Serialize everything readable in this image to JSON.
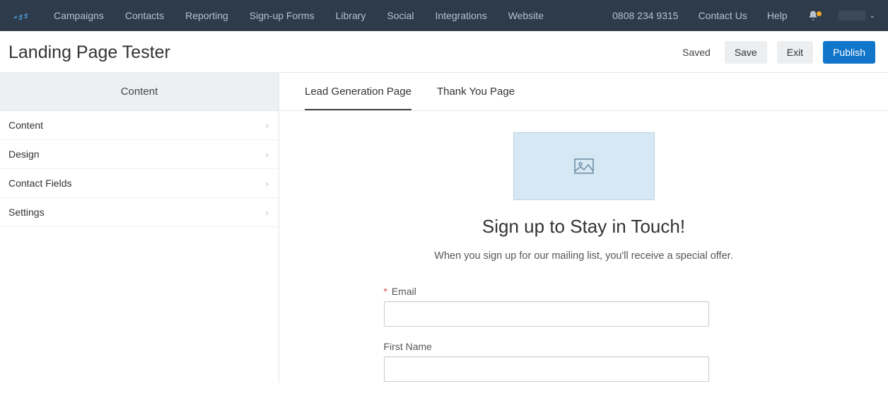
{
  "nav": {
    "items": [
      "Campaigns",
      "Contacts",
      "Reporting",
      "Sign-up Forms",
      "Library",
      "Social",
      "Integrations",
      "Website"
    ],
    "phone": "0808 234 9315",
    "contact": "Contact Us",
    "help": "Help"
  },
  "toolbar": {
    "title": "Landing Page Tester",
    "saved": "Saved",
    "save": "Save",
    "exit": "Exit",
    "publish": "Publish"
  },
  "sidebar": {
    "header": "Content",
    "items": [
      "Content",
      "Design",
      "Contact Fields",
      "Settings"
    ]
  },
  "tabs": {
    "items": [
      {
        "label": "Lead Generation Page",
        "active": true
      },
      {
        "label": "Thank You Page",
        "active": false
      }
    ]
  },
  "preview": {
    "heading": "Sign up to Stay in Touch!",
    "subheading": "When you sign up for our mailing list, you'll receive a special offer.",
    "fields": [
      {
        "label": "Email",
        "required": true,
        "value": ""
      },
      {
        "label": "First Name",
        "required": false,
        "value": ""
      }
    ]
  }
}
